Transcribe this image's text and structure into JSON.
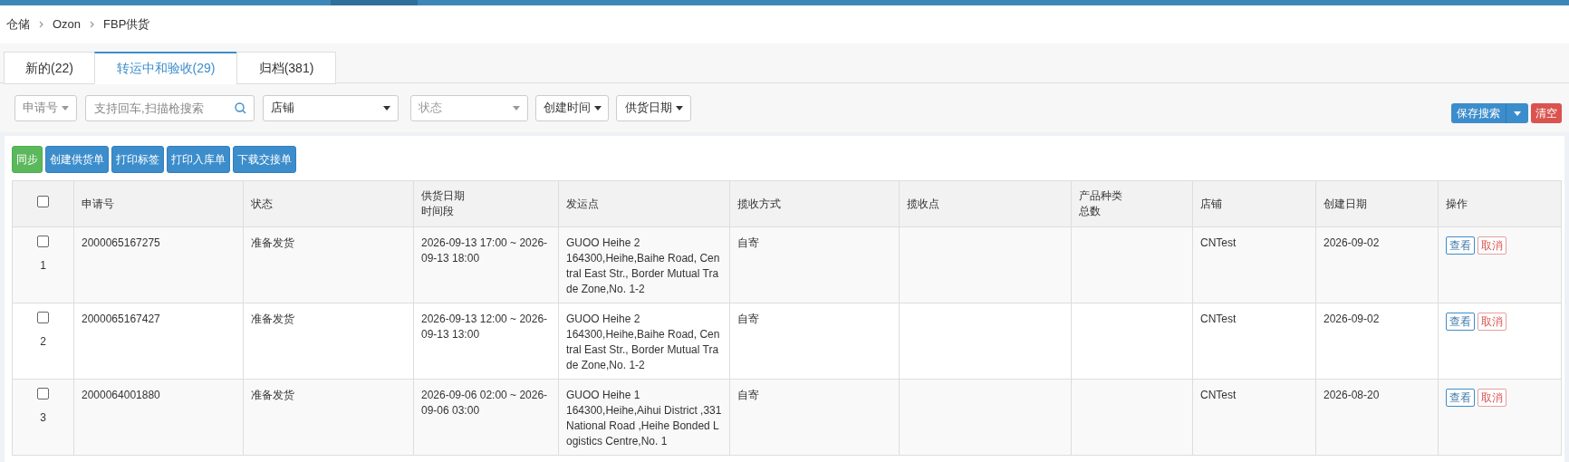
{
  "breadcrumb": [
    "仓储",
    "Ozon",
    "FBP供货"
  ],
  "tabs": [
    {
      "label": "新的(22)",
      "selected": false
    },
    {
      "label": "转运中和验收(29)",
      "selected": true
    },
    {
      "label": "归档(381)",
      "selected": false
    }
  ],
  "filters": [
    {
      "kind": "dropdown",
      "label": "申请号"
    },
    {
      "kind": "search",
      "placeholder": "支持回车,扫描枪搜索"
    },
    {
      "kind": "select",
      "placeholder": "店铺",
      "dark": true
    },
    {
      "kind": "select",
      "placeholder": "状态",
      "dark": false
    },
    {
      "kind": "dropdown",
      "label": "创建时间"
    },
    {
      "kind": "dropdown",
      "label": "供货日期"
    }
  ],
  "save_search": "保存搜索",
  "clear": "清空",
  "actions": [
    {
      "label": "同步",
      "kind": "success"
    },
    {
      "label": "创建供货单",
      "kind": "primary"
    },
    {
      "label": "打印标签",
      "kind": "primary"
    },
    {
      "label": "打印入库单",
      "kind": "primary"
    },
    {
      "label": "下载交接单",
      "kind": "primary"
    }
  ],
  "table": {
    "select_all": {
      "checked": false
    },
    "columns": [
      [
        "申请号"
      ],
      [
        "状态"
      ],
      [
        "供货日期",
        "时间段"
      ],
      [
        "发运点"
      ],
      [
        "揽收方式"
      ],
      [
        "揽收点"
      ],
      [
        "产品种类",
        "总数"
      ],
      [
        "店铺"
      ],
      [
        "创建日期"
      ],
      [
        "操作"
      ]
    ],
    "rows": [
      {
        "checked": false,
        "index": "1",
        "number": "2000065167275",
        "status": "准备发货",
        "slot": "2026-09-13 17:00 ~ 2026-09-13 18:00",
        "origin_name": "GUOO Heihe 2",
        "origin_address": "164300,Heihe,Baihe Road, Central East Str., Border Mutual Trade Zone,No. 1-2",
        "pickup": "自寄",
        "store": "CNTest",
        "created": "2026-09-02",
        "view": "查看",
        "cancel": "取消"
      },
      {
        "checked": false,
        "index": "2",
        "number": "2000065167427",
        "status": "准备发货",
        "slot": "2026-09-13 12:00 ~ 2026-09-13 13:00",
        "origin_name": "GUOO Heihe 2",
        "origin_address": "164300,Heihe,Baihe Road, Central East Str., Border Mutual Trade Zone,No. 1-2",
        "pickup": "自寄",
        "store": "CNTest",
        "created": "2026-09-02",
        "view": "查看",
        "cancel": "取消"
      },
      {
        "checked": false,
        "index": "3",
        "number": "2000064001880",
        "status": "准备发货",
        "slot": "2026-09-06 02:00 ~ 2026-09-06 03:00",
        "origin_name": "GUOO Heihe 1",
        "origin_address": "164300,Heihe,Aihui District ,331 National Road ,Heihe Bonded Logistics Centre,No. 1",
        "pickup": "自寄",
        "store": "CNTest",
        "created": "2026-08-20",
        "view": "查看",
        "cancel": "取消"
      }
    ]
  }
}
